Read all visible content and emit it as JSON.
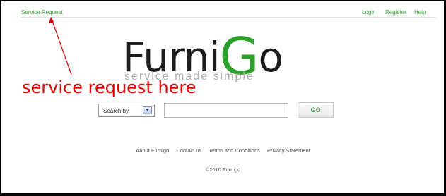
{
  "top_nav": {
    "service_request": "Service Request",
    "login": "Login",
    "register": "Register",
    "help": "Help"
  },
  "logo": {
    "word_prefix": "Furni",
    "word_g": "G",
    "word_suffix": "o",
    "tagline": "service made simple"
  },
  "annotation": {
    "text": "service request here"
  },
  "search": {
    "select_value": "Search by",
    "input_value": "",
    "go_label": "GO"
  },
  "footer": {
    "links": [
      "About Furnigo",
      "Contact us",
      "Terms and Conditions",
      "Privacy Statement"
    ],
    "copyright": "©2010 Furnigo"
  },
  "colors": {
    "brand_green": "#3aa83a",
    "annotation_red": "#e00000"
  }
}
